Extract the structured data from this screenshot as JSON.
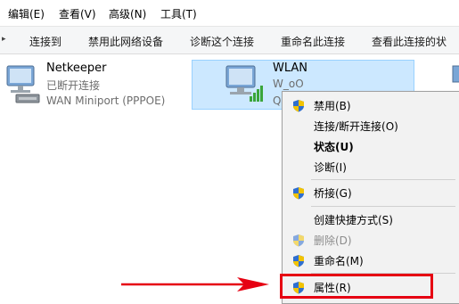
{
  "menubar": {
    "items": [
      "编辑(E)",
      "查看(V)",
      "高级(N)",
      "工具(T)"
    ]
  },
  "commandbar": {
    "items": [
      "连接到",
      "禁用此网络设备",
      "诊断这个连接",
      "重命名此连接",
      "查看此连接的状"
    ]
  },
  "adapters": [
    {
      "name": "Netkeeper",
      "status": "已断开连接",
      "device": "WAN Miniport (PPPOE)"
    },
    {
      "name": "WLAN",
      "status": "W_oO",
      "device": "Q"
    }
  ],
  "context_menu": {
    "items": [
      {
        "label": "禁用(B)",
        "shield": true,
        "bold": false,
        "disabled": false
      },
      {
        "label": "连接/断开连接(O)",
        "shield": false,
        "bold": false,
        "disabled": false
      },
      {
        "label": "状态(U)",
        "shield": false,
        "bold": true,
        "disabled": false
      },
      {
        "label": "诊断(I)",
        "shield": false,
        "bold": false,
        "disabled": false
      },
      {
        "label": "桥接(G)",
        "shield": true,
        "bold": false,
        "disabled": false
      },
      {
        "label": "创建快捷方式(S)",
        "shield": false,
        "bold": false,
        "disabled": false
      },
      {
        "label": "删除(D)",
        "shield": true,
        "bold": false,
        "disabled": true
      },
      {
        "label": "重命名(M)",
        "shield": true,
        "bold": false,
        "disabled": false
      },
      {
        "label": "属性(R)",
        "shield": true,
        "bold": false,
        "disabled": false
      }
    ]
  },
  "colors": {
    "selection_bg": "#cce8ff",
    "highlight_border": "#e60012",
    "arrow": "#e60012",
    "shield_blue": "#2f6fd0",
    "shield_yellow": "#f2c300"
  }
}
